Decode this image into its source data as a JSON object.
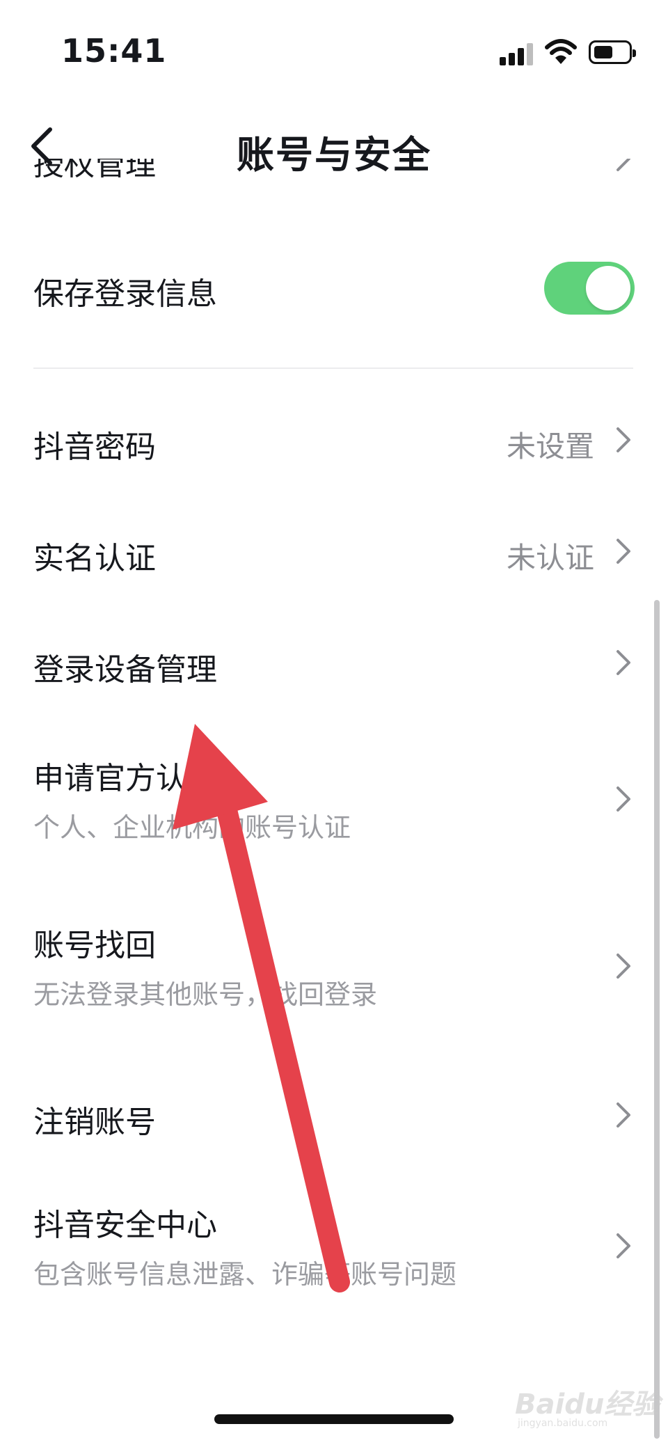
{
  "status": {
    "time": "15:41"
  },
  "nav": {
    "title": "账号与安全"
  },
  "rows": {
    "authorization": {
      "label": "授权管理"
    },
    "save_login": {
      "label": "保存登录信息",
      "toggle_on": true
    },
    "password": {
      "label": "抖音密码",
      "value": "未设置"
    },
    "realname": {
      "label": "实名认证",
      "value": "未认证"
    },
    "devices": {
      "label": "登录设备管理"
    },
    "official": {
      "label": "申请官方认证",
      "sub": "个人、企业机构的账号认证"
    },
    "recover": {
      "label": "账号找回",
      "sub": "无法登录其他账号，找回登录"
    },
    "cancel": {
      "label": "注销账号"
    },
    "safety": {
      "label": "抖音安全中心",
      "sub": "包含账号信息泄露、诈骗等账号问题"
    }
  },
  "colors": {
    "toggle": "#5fd27b",
    "arrow": "#e5424b"
  },
  "watermark": {
    "main": "Baidu经验",
    "sub": "jingyan.baidu.com"
  }
}
